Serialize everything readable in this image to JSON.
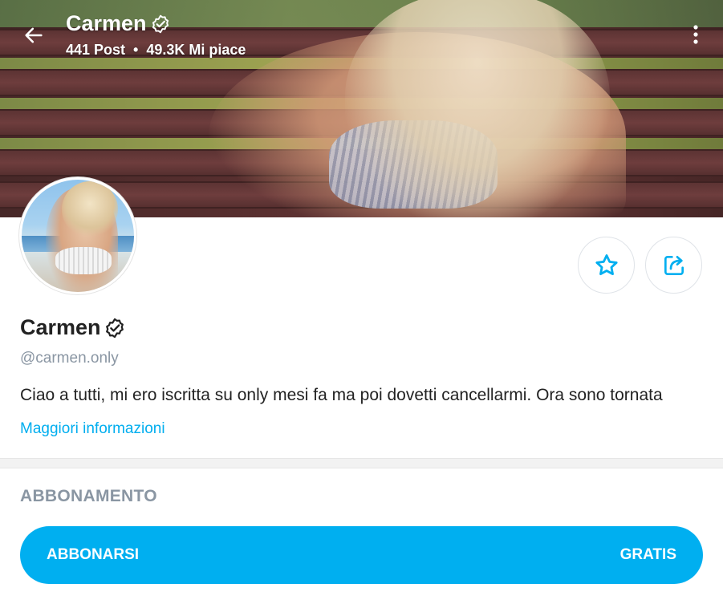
{
  "header": {
    "name": "Carmen",
    "posts": "441 Post",
    "likes": "49.3K Mi piace",
    "separator": "•"
  },
  "profile": {
    "name": "Carmen",
    "handle": "@carmen.only",
    "bio": "Ciao a tutti, mi ero iscritta su only mesi fa ma poi dovetti cancellarmi. Ora sono tornata",
    "more_info": "Maggiori informazioni"
  },
  "subscription": {
    "title": "ABBONAMENTO",
    "button_label": "ABBONARSI",
    "price": "GRATIS"
  },
  "icons": {
    "back": "arrow-left-icon",
    "verified": "verified-badge-icon",
    "more": "more-vertical-icon",
    "favorite": "star-icon",
    "share": "share-icon"
  },
  "colors": {
    "accent": "#00aff0",
    "muted": "#8a96a3",
    "text": "#222222"
  }
}
